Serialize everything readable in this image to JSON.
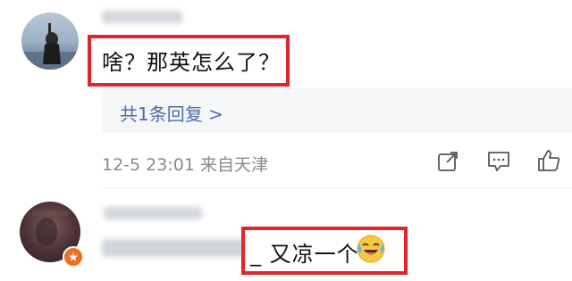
{
  "comments": [
    {
      "content": "啥？那英怎么了？",
      "replies_link": "共1条回复 >",
      "meta": "12-5 23:01 来自天津",
      "actions": [
        {
          "icon": "share-icon"
        },
        {
          "icon": "comment-icon"
        },
        {
          "icon": "like-icon"
        }
      ]
    },
    {
      "content_tail": "_ 又凉一个",
      "emoji": "laughing-crying-emoji"
    }
  ],
  "colors": {
    "highlight": "#e0262b",
    "link": "#4a6fa5",
    "meta": "#8a8a8a",
    "panel": "#f5f6f8",
    "divider": "#ececec"
  }
}
